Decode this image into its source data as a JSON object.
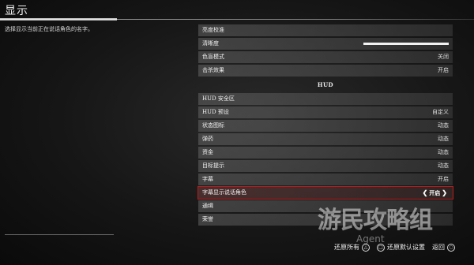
{
  "page": {
    "title": "显示"
  },
  "description": "选择显示当前正在说话角色的名字。",
  "menu": {
    "top_items": [
      {
        "label": "亮度校准",
        "value": ""
      },
      {
        "label": "清晰度",
        "value": ""
      },
      {
        "label": "色盲模式",
        "value": "关闭"
      },
      {
        "label": "击杀效果",
        "value": "开启"
      }
    ],
    "clarity_slider_level": 1.0,
    "section_header": "HUD",
    "hud_items": [
      {
        "label": "HUD 安全区",
        "value": ""
      },
      {
        "label": "HUD 预设",
        "value": "自定义"
      },
      {
        "label": "状态图标",
        "value": "动态"
      },
      {
        "label": "弹药",
        "value": "动态"
      },
      {
        "label": "资金",
        "value": "动态"
      },
      {
        "label": "目标提示",
        "value": "动态"
      },
      {
        "label": "字幕",
        "value": "开启"
      },
      {
        "label": "字幕显示说话角色",
        "value": "开启",
        "selected": true
      },
      {
        "label": "通缉",
        "value": ""
      },
      {
        "label": "荣誉",
        "value": ""
      }
    ]
  },
  "footer": {
    "restore_all": "还原所有",
    "restore_defaults": "还原默认设置",
    "back": "返回"
  },
  "watermark": {
    "main": "游民攻略组",
    "sub": "Agent"
  },
  "colors": {
    "selected_outline": "#b71c1c"
  }
}
